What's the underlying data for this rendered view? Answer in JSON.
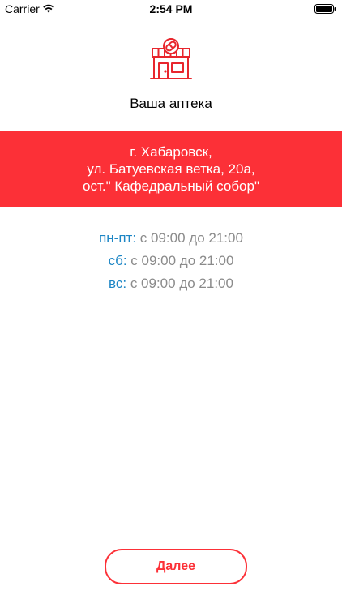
{
  "status_bar": {
    "carrier": "Carrier",
    "time": "2:54 PM"
  },
  "header": {
    "icon": "pharmacy-storefront-icon",
    "title": "Ваша аптека"
  },
  "address": {
    "lines": [
      "г. Хабаровск,",
      "ул. Батуевская ветка, 20а,",
      "ост.\" Кафедральный собор\""
    ]
  },
  "schedule": [
    {
      "days": "пн-пт",
      "hours": "с 09:00 до 21:00"
    },
    {
      "days": "сб",
      "hours": "с 09:00 до 21:00"
    },
    {
      "days": "вс",
      "hours": "с 09:00 до 21:00"
    }
  ],
  "next_button": {
    "label": "Далее"
  },
  "colors": {
    "accent_red": "#fc3037",
    "day_label_blue": "#1d86c5",
    "hours_gray": "#8b8b8b"
  }
}
